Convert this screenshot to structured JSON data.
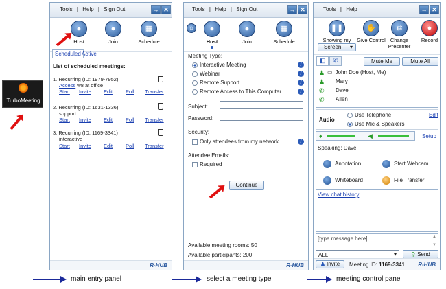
{
  "app": {
    "name": "TurboMeeting"
  },
  "panel1": {
    "menu": [
      "Tools",
      "|",
      "Help",
      "|",
      "Sign Out"
    ],
    "actions": [
      "Host",
      "Join",
      "Schedule"
    ],
    "tabs": [
      "Scheduled",
      "Active"
    ],
    "list_title": "List of scheduled meetings:",
    "meetings": [
      {
        "title": "1. Recurring (ID: 1979-7952)",
        "sub_link": "Access",
        "sub_text": "w8 at office",
        "links": [
          "Start",
          "Invite",
          "Edit",
          "Poll",
          "Transfer"
        ]
      },
      {
        "title": "2. Recurring (ID: 1631-1336)",
        "sub_link": "",
        "sub_text": "support",
        "links": [
          "Start",
          "Invite",
          "Edit",
          "Poll",
          "Transfer"
        ]
      },
      {
        "title": "3. Recurring (ID: 1169-3341)",
        "sub_link": "",
        "sub_text": "interactive",
        "links": [
          "Start",
          "Invite",
          "Edit",
          "Poll",
          "Transfer"
        ]
      }
    ],
    "logo": "R-HUB"
  },
  "panel2": {
    "menu": [
      "Tools",
      "|",
      "Help",
      "|",
      "Sign Out"
    ],
    "actions": [
      "Host",
      "Join",
      "Schedule"
    ],
    "meeting_type_label": "Meeting Type:",
    "types": [
      "Interactive Meeting",
      "Webinar",
      "Remote Support",
      "Remote Access to This Computer"
    ],
    "subject_label": "Subject:",
    "password_label": "Password:",
    "security_label": "Security:",
    "security_option": "Only attendees from my network",
    "emails_label": "Attendee Emails:",
    "required_label": "Required",
    "continue": "Continue",
    "rooms": "Available meeting rooms: 50",
    "participants": "Available participants: 200",
    "logo": "R-HUB"
  },
  "panel3": {
    "menu": [
      "Tools",
      "|",
      "Help"
    ],
    "actions": [
      "Showing my",
      "Give Control",
      "Change Presenter",
      "Record"
    ],
    "screen_dropdown": "Screen",
    "mute_me": "Mute Me",
    "mute_all": "Mute All",
    "attendees": [
      "John Doe (Host, Me)",
      "Mary",
      "Dave",
      "Allen"
    ],
    "audio_label": "Audio",
    "audio_options": [
      "Use Telephone",
      "Use Mic & Speakers"
    ],
    "edit": "Edit",
    "setup": "Setup",
    "speaking": "Speaking: Dave",
    "features": [
      "Annotation",
      "Start Webcam",
      "Whiteboard",
      "File Transfer"
    ],
    "chat_history": "View chat history",
    "chat_placeholder": "[type message here]",
    "recipient": "ALL",
    "send": "Send",
    "invite": "Invite",
    "meeting_id_label": "Meeting ID:",
    "meeting_id": "1169-3341",
    "logo": "R-HUB"
  },
  "captions": [
    "main entry panel",
    "select a meeting type",
    "meeting control panel"
  ]
}
